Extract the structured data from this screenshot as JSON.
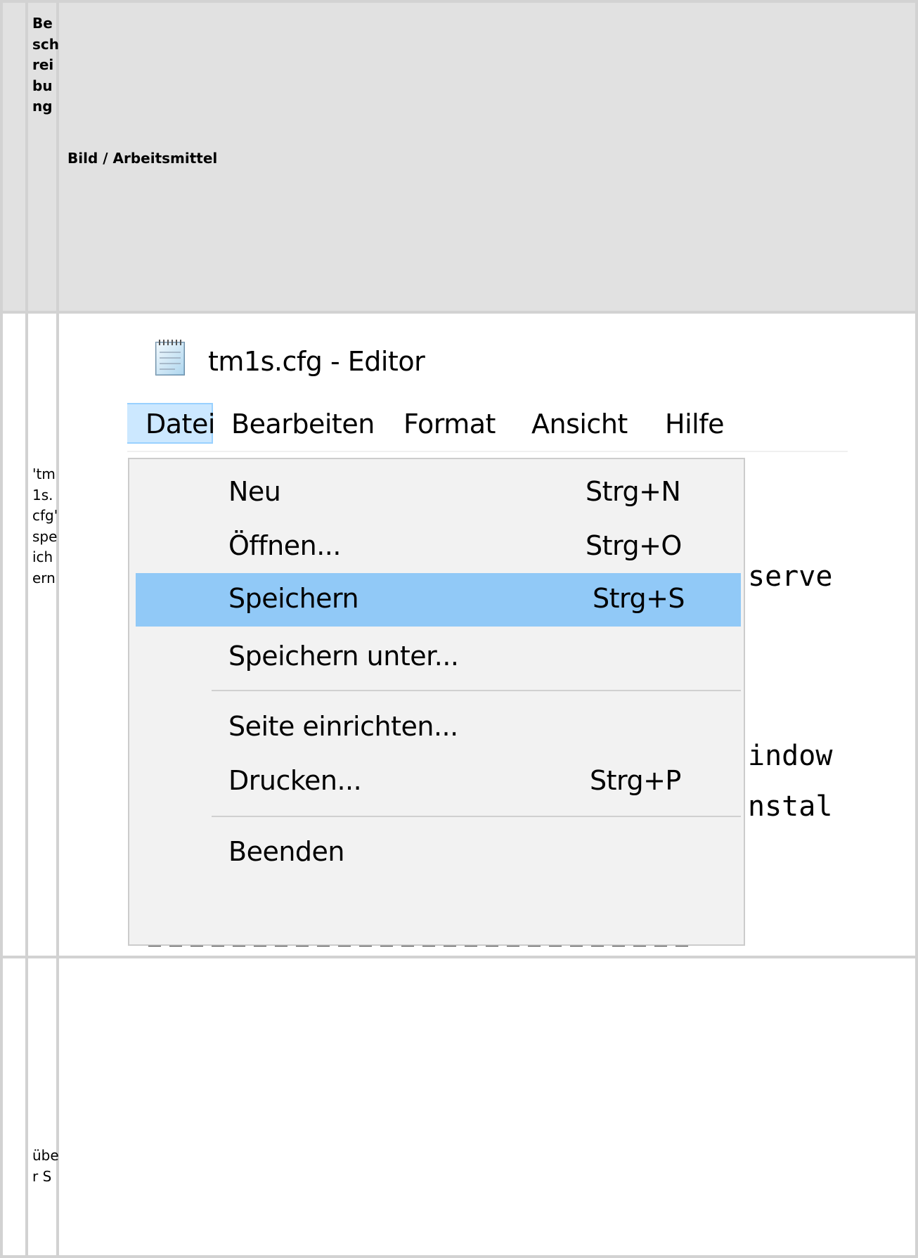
{
  "table": {
    "header": {
      "column1": "Beschreibung",
      "column2": "Bild / Arbeitsmittel"
    },
    "rows": [
      {
        "description": "'tm1s.cfg' speichern"
      },
      {
        "description": "über S"
      }
    ]
  },
  "editor": {
    "window_title": "tm1s.cfg - Editor",
    "icon": "notepad-icon",
    "menu": [
      "Datei",
      "Bearbeiten",
      "Format",
      "Ansicht",
      "Hilfe"
    ],
    "active_menu": "Datei",
    "background_text": [
      "serve",
      "indow",
      "nstal"
    ],
    "dropdown": [
      {
        "label": "Neu",
        "shortcut": "Strg+N"
      },
      {
        "label": "Öffnen...",
        "shortcut": "Strg+O"
      },
      {
        "label": "Speichern",
        "shortcut": "Strg+S",
        "highlighted": true
      },
      {
        "label": "Speichern unter...",
        "shortcut": ""
      },
      {
        "label": "Seite einrichten...",
        "shortcut": ""
      },
      {
        "label": "Drucken...",
        "shortcut": "Strg+P"
      },
      {
        "label": "Beenden",
        "shortcut": ""
      }
    ]
  },
  "colors": {
    "header_bg": "#e1e1e1",
    "border": "#d2d2d2",
    "menu_active_bg": "#cce8ff",
    "menu_highlight_bg": "#91c9f7",
    "dropdown_bg": "#f2f2f2"
  }
}
